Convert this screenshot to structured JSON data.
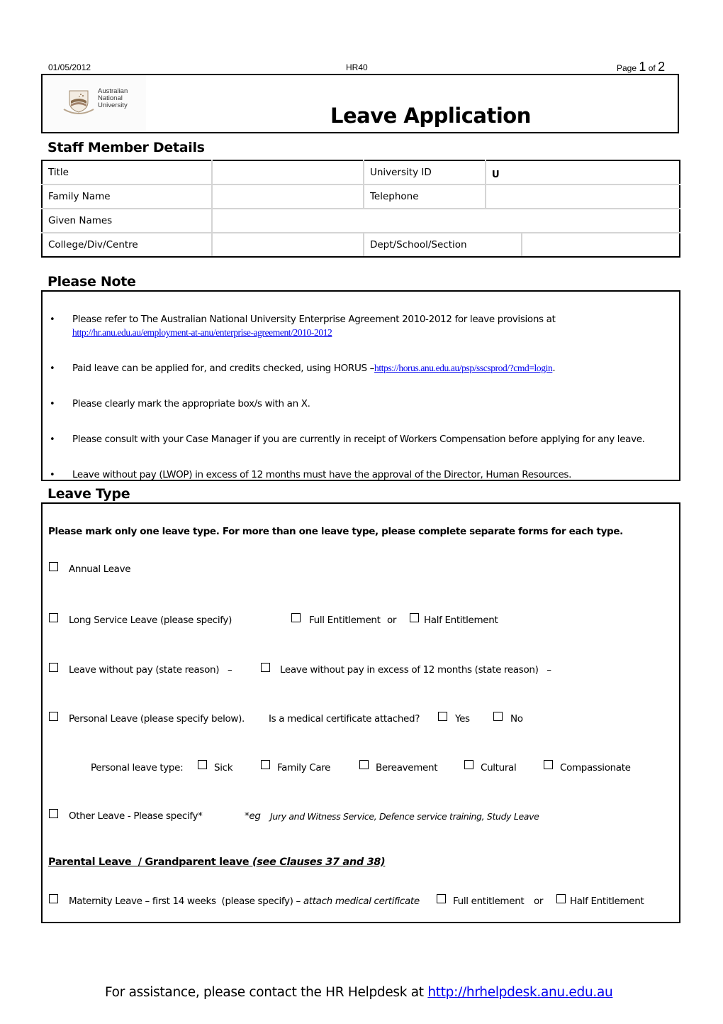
{
  "header": {
    "date": "01/05/2012",
    "form_code": "HR40",
    "page_prefix": "Page",
    "page_current": "1",
    "page_of": "of",
    "page_total": "2"
  },
  "logo": {
    "line1": "Australian",
    "line2": "National",
    "line3": "University"
  },
  "title": "Leave Application",
  "staff_section": {
    "heading": "Staff Member Details",
    "rows": [
      {
        "label1": "Title",
        "value1": "",
        "label2": "University ID",
        "value2": "U"
      },
      {
        "label1": "Family Name",
        "value1": "",
        "label2": "Telephone",
        "value2": ""
      },
      {
        "label1": "Given Names",
        "value1": ""
      },
      {
        "label1": "College/Div/Centre",
        "value1": "",
        "label2": "Dept/School/Section",
        "value2": ""
      }
    ]
  },
  "note_section": {
    "heading": "Please Note",
    "items": [
      {
        "text": "Please refer to The Australian National University Enterprise Agreement 2010-2012 for leave provisions at",
        "link": "http://hr.anu.edu.au/employment-at-anu/enterprise-agreement/2010-2012"
      },
      {
        "text": "Paid leave can be applied for, and credits checked, using HORUS –",
        "link": "https://horus.anu.edu.au/psp/sscsprod/?cmd=login",
        "suffix": "."
      },
      {
        "text": "Please clearly mark the appropriate box/s with an X."
      },
      {
        "text": "Please consult with your Case Manager if you are currently in receipt of Workers Compensation before applying for any leave."
      },
      {
        "text": "Leave without pay (LWOP) in excess of 12 months must have the approval of the Director, Human Resources."
      }
    ]
  },
  "leave_section": {
    "heading": "Leave Type",
    "instruction": "Please mark only one leave type.  For more than one leave type, please complete separate forms for each type.",
    "annual": "Annual Leave",
    "long_service": "Long Service Leave   (please specify)",
    "ls_full": "Full Entitlement",
    "ls_or": "or",
    "ls_half": "Half Entitlement",
    "lwop": "Leave without pay (state reason)   –",
    "lwop_12": "Leave without pay in excess of 12 months (state reason)   –",
    "personal": "Personal Leave  (please specify below).",
    "med_cert_q": "Is a medical certificate attached?",
    "yes": "Yes",
    "no": "No",
    "personal_type_label": "Personal leave type:",
    "personal_types": [
      "Sick",
      "Family Care",
      "Bereavement",
      "Cultural",
      "Compassionate"
    ],
    "other": "Other Leave - Please specify*",
    "other_eg_prefix": "*eg",
    "other_eg": "Jury and Witness Service, Defence service training, Study Leave",
    "parental_heading": "Parental Leave  / Grandparent leave ",
    "parental_clauses": "(see Clauses 37 and 38)",
    "maternity": "Maternity Leave – first 14 weeks  (please specify) – ",
    "maternity_note": "attach medical certificate",
    "mat_full": "Full entitlement",
    "mat_or": "or",
    "mat_half": "Half Entitlement"
  },
  "footer": {
    "text": "For assistance, please contact the HR Helpdesk at ",
    "link": "http://hrhelpdesk.anu.edu.au"
  }
}
